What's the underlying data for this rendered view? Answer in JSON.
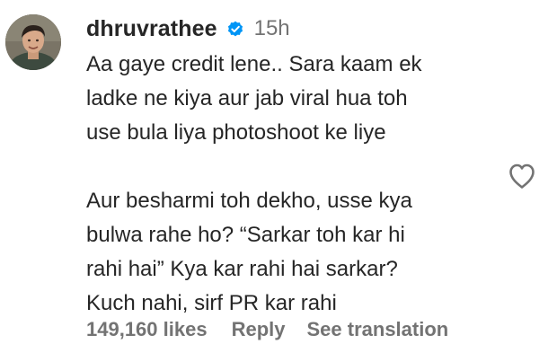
{
  "comment": {
    "username": "dhruvrathee",
    "verified_icon": "verified-badge-icon",
    "verified_color": "#0095f6",
    "timestamp": "15h",
    "lines": [
      "Aa gaye credit lene.. Sara kaam ek",
      "ladke ne kiya aur jab viral hua toh",
      "use bula liya photoshoot ke liye",
      "",
      "Aur besharmi toh dekho, usse kya",
      "bulwa rahe ho? “Sarkar toh kar hi",
      "rahi hai” Kya kar rahi hai sarkar?",
      "Kuch nahi, sirf PR kar rahi"
    ],
    "likes": "149,160 likes",
    "reply_label": "Reply",
    "translate_label": "See translation",
    "like_icon": "heart-outline-icon"
  },
  "colors": {
    "text_primary": "#262626",
    "text_secondary": "#737373",
    "background": "#ffffff"
  }
}
